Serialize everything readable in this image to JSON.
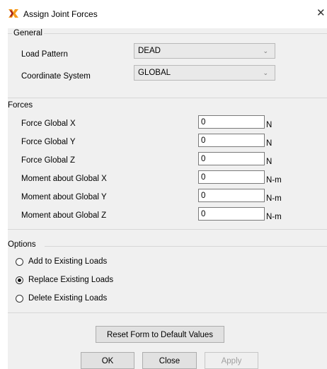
{
  "window": {
    "title": "Assign Joint Forces",
    "close_glyph": "✕",
    "icon": "app-logo-icon"
  },
  "general": {
    "heading": "General",
    "load_pattern_label": "Load Pattern",
    "load_pattern_value": "DEAD",
    "coord_system_label": "Coordinate System",
    "coord_system_value": "GLOBAL",
    "dropdown_glyph": "⌄"
  },
  "forces": {
    "heading": "Forces",
    "rows": [
      {
        "label": "Force Global X",
        "value": "0",
        "unit": "N"
      },
      {
        "label": "Force Global Y",
        "value": "0",
        "unit": "N"
      },
      {
        "label": "Force Global Z",
        "value": "0",
        "unit": "N"
      },
      {
        "label": "Moment about Global X",
        "value": "0",
        "unit": "N-m"
      },
      {
        "label": "Moment about Global Y",
        "value": "0",
        "unit": "N-m"
      },
      {
        "label": "Moment about Global Z",
        "value": "0",
        "unit": "N-m"
      }
    ]
  },
  "options": {
    "heading": "Options",
    "items": [
      {
        "label": "Add to Existing Loads",
        "selected": false
      },
      {
        "label": "Replace Existing Loads",
        "selected": true
      },
      {
        "label": "Delete Existing Loads",
        "selected": false
      }
    ]
  },
  "buttons": {
    "reset": "Reset Form to Default Values",
    "ok": "OK",
    "close": "Close",
    "apply": "Apply"
  },
  "colors": {
    "icon_orange": "#f59a1b",
    "icon_dark": "#a5221b"
  }
}
